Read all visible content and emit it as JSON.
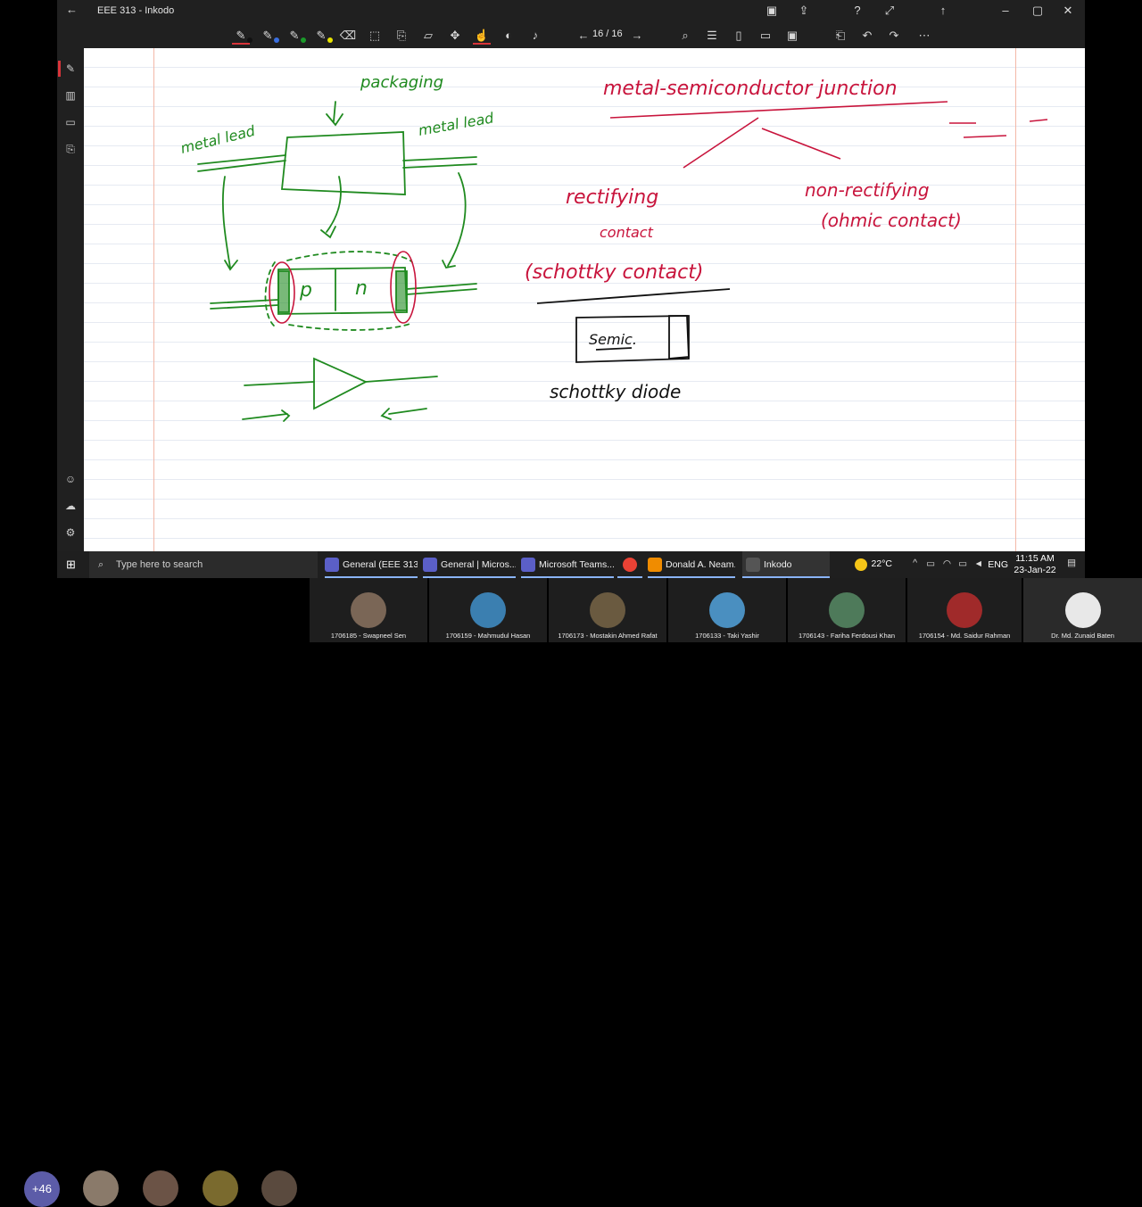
{
  "app": {
    "title": "EEE 313 - Inkodo",
    "page_indicator": "16 / 16"
  },
  "notes": {
    "left": {
      "packaging": "packaging",
      "metal_lead_left": "metal lead",
      "metal_lead_right": "metal lead",
      "p": "p",
      "n": "n"
    },
    "right": {
      "heading": "metal-semiconductor junction",
      "rectifying": "rectifying",
      "contact": "contact",
      "schottky_contact": "(schottky contact)",
      "non_rectifying": "non-rectifying",
      "ohmic_contact": "(ohmic contact)",
      "semic": "Semic.",
      "schottky_diode": "schottky diode"
    }
  },
  "taskbar": {
    "search_placeholder": "Type here to search",
    "apps": [
      {
        "label": "General (EEE 313...",
        "color": "#5b5fc7"
      },
      {
        "label": "General | Micros...",
        "color": "#5b5fc7"
      },
      {
        "label": "Microsoft Teams...",
        "color": "#5b5fc7"
      },
      {
        "label": "",
        "color": "#e94235"
      },
      {
        "label": "Donald A. Neam...",
        "color": "#f08c00"
      },
      {
        "label": "Inkodo",
        "color": "#3a3a3a"
      }
    ],
    "weather": "22°C",
    "lang": "ENG",
    "time": "11:15 AM",
    "date": "23-Jan-22"
  },
  "meeting": {
    "overflow_count": "+46",
    "participants": [
      {
        "name": "1706185 - Swapneel Sen"
      },
      {
        "name": "1706159 - Mahmudul Hasan"
      },
      {
        "name": "1706173 - Mostakin Ahmed Rafat"
      },
      {
        "name": "1706133 - Taki Yashir"
      },
      {
        "name": "1706143 - Fariha Ferdousi Khan"
      },
      {
        "name": "1706154 - Md. Saidur  Rahman"
      },
      {
        "name": "Dr. Md. Zunaid Baten"
      }
    ]
  }
}
